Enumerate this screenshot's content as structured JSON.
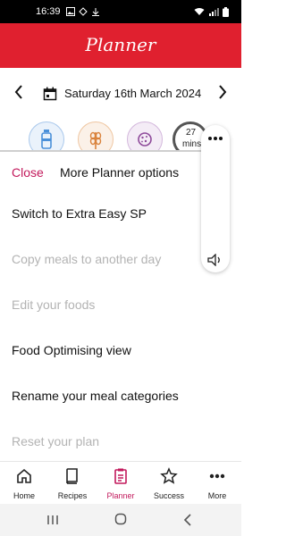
{
  "status_bar": {
    "time": "16:39"
  },
  "header": {
    "title": "Planner"
  },
  "date_nav": {
    "date": "Saturday 16th March 2024"
  },
  "trackers": {
    "timer_value": "27",
    "timer_unit": "mins"
  },
  "sheet": {
    "close_label": "Close",
    "title": "More Planner options",
    "items": [
      {
        "label": "Switch to Extra Easy SP",
        "enabled": true
      },
      {
        "label": "Copy meals to another day",
        "enabled": false
      },
      {
        "label": "Edit your foods",
        "enabled": false
      },
      {
        "label": "Food Optimising view",
        "enabled": true
      },
      {
        "label": "Rename your meal categories",
        "enabled": true
      },
      {
        "label": "Reset your plan",
        "enabled": false
      }
    ]
  },
  "bottom_nav": {
    "items": [
      {
        "label": "Home",
        "icon": "home-icon"
      },
      {
        "label": "Recipes",
        "icon": "book-icon"
      },
      {
        "label": "Planner",
        "icon": "planner-icon",
        "active": true
      },
      {
        "label": "Success",
        "icon": "star-icon"
      },
      {
        "label": "More",
        "icon": "more-icon"
      }
    ]
  },
  "colors": {
    "brand": "#e0202f",
    "active": "#c2185b",
    "disabled": "#b3b3b3",
    "water": "#4a90d9",
    "grain": "#d9823b",
    "treat": "#8e4a9a"
  }
}
